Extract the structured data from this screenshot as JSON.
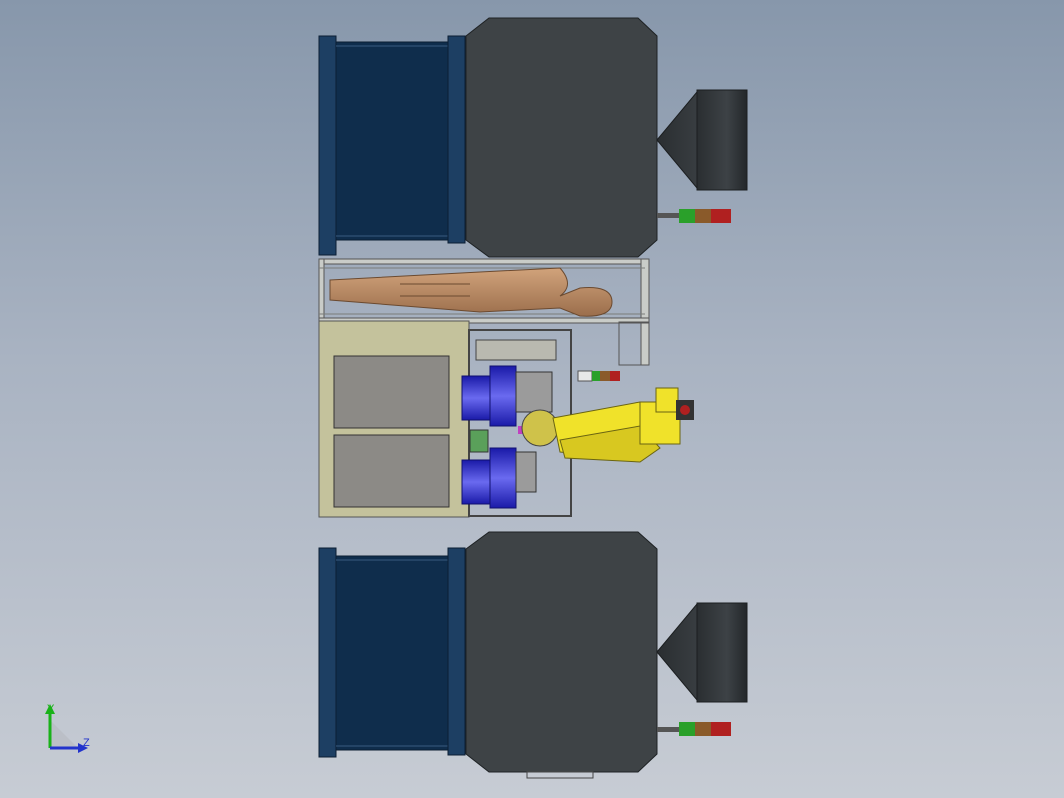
{
  "viewport": {
    "background_top": "#8797ab",
    "background_bottom": "#c7ccd4"
  },
  "triad": {
    "x_label": "Y",
    "z_label": "Z",
    "y_color": "#19b219",
    "z_color": "#2233cc"
  },
  "colors": {
    "drum_navy": "#0f2d4c",
    "drum_flange": "#1d3f63",
    "cabinet_gray": "#3e4346",
    "cone_dark": "#2e3235",
    "frame_gray": "#c9ccc8",
    "robot_yellow": "#f0e22a",
    "motor_blue": "#3a3ad6",
    "panel_beige": "#c4c29c",
    "panel_gray": "#8c8a86",
    "mannequin_tan": "#b98a63",
    "light_green": "#2aa02a",
    "light_brown": "#8a5a2a",
    "light_red": "#b02020"
  }
}
